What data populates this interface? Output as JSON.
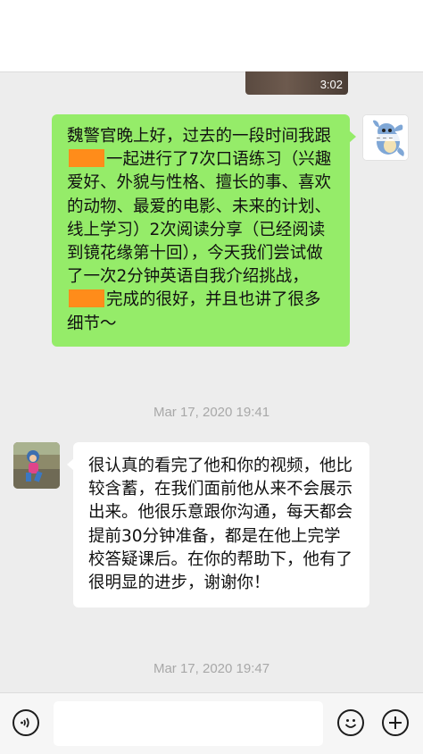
{
  "video": {
    "duration": "3:02"
  },
  "messages": [
    {
      "side": "outgoing",
      "text_part1": "魏警官晚上好，过去的一段时间我跟",
      "text_part2": "一起进行了7次口语练习（兴趣爱好、外貌与性格、擅长的事、喜欢的动物、最爱的电影、未来的计划、线上学习）2次阅读分享（已经阅读到镜花缘第十回），今天我们尝试做了一次2分钟英语自我介绍挑战，",
      "text_part3": "完成的很好，并且也讲了很多细节～"
    },
    {
      "side": "incoming",
      "text": "很认真的看完了他和你的视频，他比较含蓄，在我们面前他从来不会展示出来。他很乐意跟你沟通，每天都会提前30分钟准备，都是在他上完学校答疑课后。在你的帮助下，他有了很明显的进步，谢谢你！"
    }
  ],
  "timestamps": [
    "Mar 17, 2020 19:41",
    "Mar 17, 2020 19:47"
  ],
  "input": {
    "value": "",
    "placeholder": ""
  },
  "icons": {
    "voice": "voice-icon",
    "emoji": "emoji-icon",
    "plus": "plus-icon",
    "redaction": "redaction-block"
  },
  "colors": {
    "outgoing_bubble": "#95ec69",
    "incoming_bubble": "#ffffff",
    "background": "#ededed",
    "redaction": "#ff8c1a"
  }
}
